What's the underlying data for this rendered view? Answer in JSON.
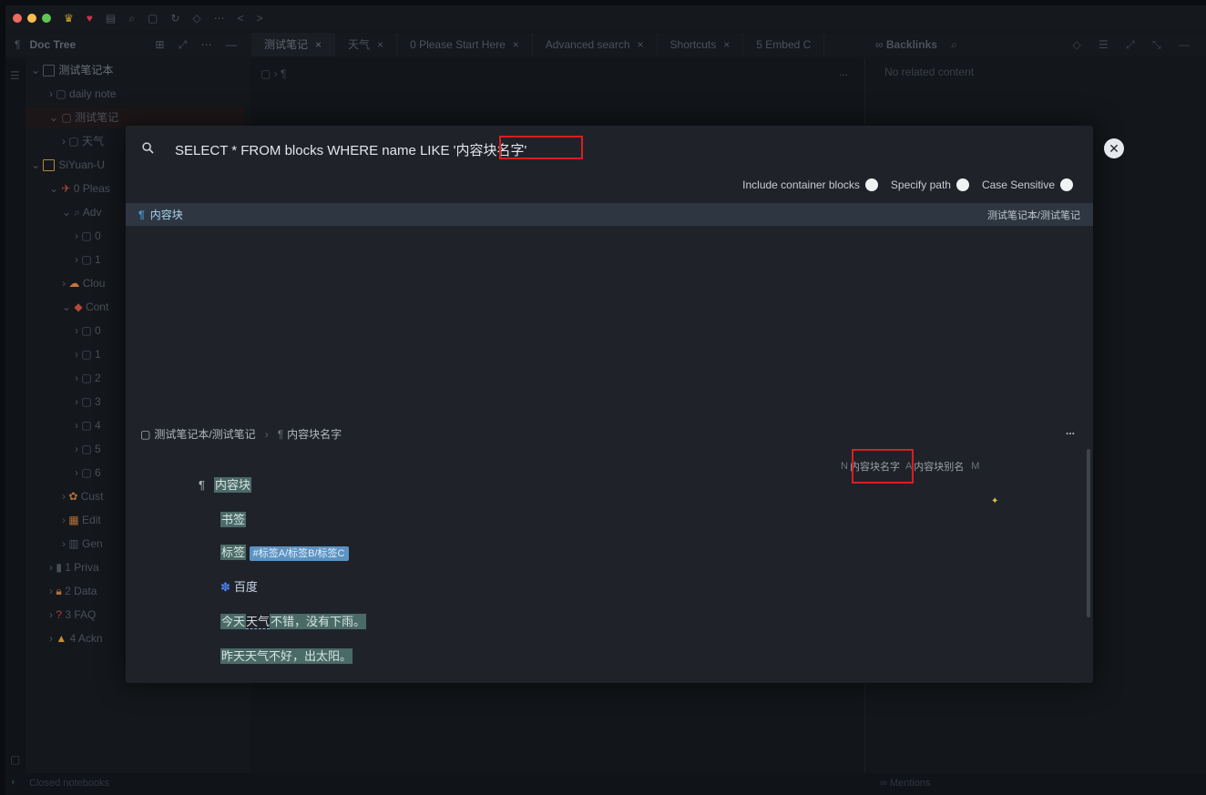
{
  "toolbar": {
    "more_label": "⋯",
    "back_label": "<",
    "forward_label": ">"
  },
  "tabs": {
    "doc_tree_label": "Doc Tree",
    "items": [
      {
        "label": "测试笔记"
      },
      {
        "label": "天气"
      },
      {
        "label": "0 Please Start Here"
      },
      {
        "label": "Advanced search"
      },
      {
        "label": "Shortcuts"
      },
      {
        "label": "5 Embed C"
      }
    ],
    "backlinks_label": "Backlinks"
  },
  "sidebar": {
    "items": [
      {
        "label": "测试笔记本"
      },
      {
        "label": "daily note"
      },
      {
        "label": "测试笔记"
      },
      {
        "label": "天气"
      },
      {
        "label": "SiYuan-U"
      },
      {
        "label": "0 Pleas"
      },
      {
        "label": "Adv"
      },
      {
        "label": "0"
      },
      {
        "label": "1"
      },
      {
        "label": "Clou"
      },
      {
        "label": "Cont"
      },
      {
        "label": "0"
      },
      {
        "label": "1"
      },
      {
        "label": "2"
      },
      {
        "label": "3"
      },
      {
        "label": "4"
      },
      {
        "label": "5"
      },
      {
        "label": "6"
      },
      {
        "label": "Cust"
      },
      {
        "label": "Edit"
      },
      {
        "label": "Gen"
      },
      {
        "label": "1 Priva"
      },
      {
        "label": "2 Data"
      },
      {
        "label": "3 FAQ"
      },
      {
        "label": "4 Ackn"
      }
    ],
    "closed_notebooks": "Closed notebooks"
  },
  "doc": {
    "crumb": "¶",
    "more": "..."
  },
  "right_panel": {
    "no_related": "No related content",
    "mentions_label": "Mentions"
  },
  "dialog": {
    "query": "SELECT * FROM blocks WHERE name LIKE '内容块名字'",
    "options": {
      "include_container": "Include container blocks",
      "specify_path": "Specify path",
      "case_sensitive": "Case Sensitive"
    },
    "result": {
      "label": "内容块",
      "path": "测试笔记本/测试笔记"
    },
    "preview": {
      "path": "测试笔记本/测试笔记",
      "block_name": "内容块名字",
      "more": "...",
      "attrs": {
        "name_badge": "N",
        "name": "内容块名字",
        "alias_badge": "A",
        "alias": "内容块别名",
        "memo_badge": "M"
      },
      "lines": {
        "title": "内容块",
        "bookmark": "书签",
        "tag_label": "标签",
        "tag_value": "#标签A/标签B/标签C",
        "baidu": "百度",
        "weather_today_a": "今天",
        "weather_today_b": "天气",
        "weather_today_c": "不错，没有下雨。",
        "weather_yesterday": "昨天天气不好，出太阳。"
      }
    },
    "close_label": "✕"
  },
  "colors": {
    "accent": "#4f9ad2",
    "highlight_box": "#d81e23",
    "dialog_bg": "#1f2329"
  }
}
